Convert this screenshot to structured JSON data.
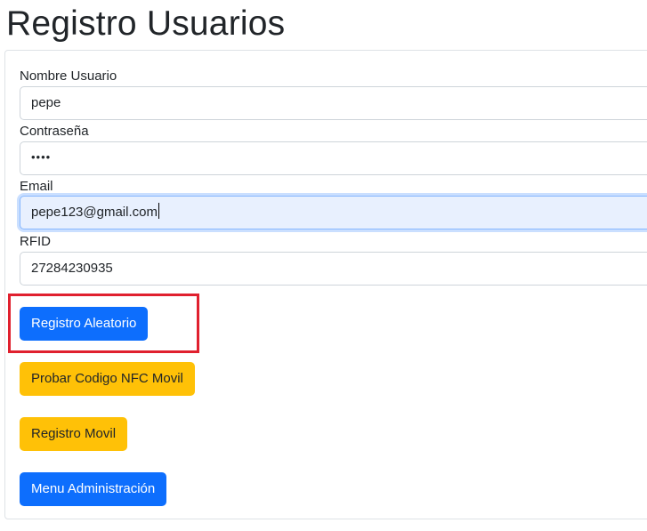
{
  "page": {
    "title": "Registro Usuarios"
  },
  "form": {
    "username": {
      "label": "Nombre Usuario",
      "value": "pepe"
    },
    "password": {
      "label": "Contraseña",
      "masked_value": "••••"
    },
    "email": {
      "label": "Email",
      "value": "pepe123@gmail.com",
      "focused": true
    },
    "rfid": {
      "label": "RFID",
      "value": "27284230935"
    }
  },
  "buttons": {
    "random_register": "Registro Aleatorio",
    "test_nfc": "Probar Codigo NFC Movil",
    "mobile_register": "Registro Movil",
    "admin_menu": "Menu Administración"
  },
  "colors": {
    "primary": "#0d6efd",
    "warning": "#ffc107",
    "highlight": "#e0202e",
    "focus_bg": "#e8f0fe"
  }
}
